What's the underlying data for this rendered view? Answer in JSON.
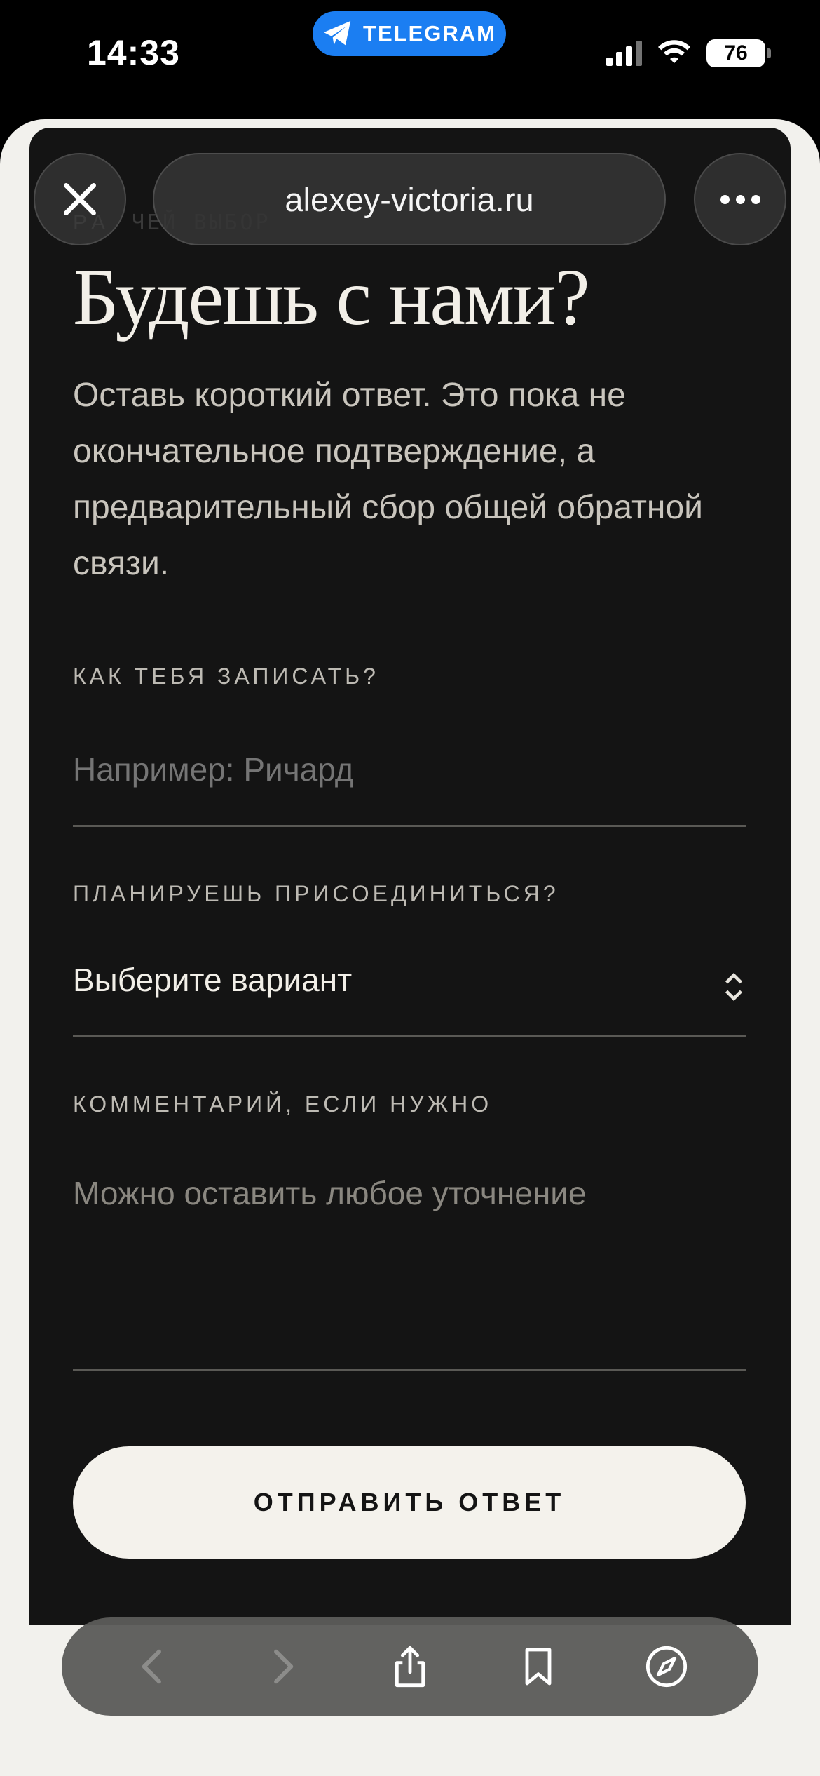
{
  "status_bar": {
    "time": "14:33",
    "app_pill": "TELEGRAM",
    "battery": "76"
  },
  "browser": {
    "url": "alexey-victoria.ru",
    "close_icon": "close-icon",
    "more_icon": "more-icon"
  },
  "page": {
    "eyebrow": "РА",
    "eyebrow_ghost": "ЧЕЙ ВЫБОР",
    "heading": "Будешь с нами?",
    "intro": "Оставь короткий ответ. Это пока не окончательное подтверждение, а предварительный сбор общей обратной связи.",
    "name_field": {
      "label": "КАК ТЕБЯ ЗАПИСАТЬ?",
      "placeholder": "Например: Ричард"
    },
    "join_field": {
      "label": "ПЛАНИРУЕШЬ ПРИСОЕДИНИТЬСЯ?",
      "selected": "Выберите вариант"
    },
    "comment_field": {
      "label": "КОММЕНТАРИЙ, ЕСЛИ НУЖНО",
      "placeholder": "Можно оставить любое уточнение"
    },
    "submit_label": "ОТПРАВИТЬ ОТВЕТ"
  },
  "toolbar": {
    "icons": [
      "back-icon",
      "forward-icon",
      "share-icon",
      "bookmark-icon",
      "compass-icon"
    ]
  },
  "colors": {
    "telegram": "#1b7ef2",
    "page_bg": "#141414",
    "text_light": "#f2efe8",
    "button_bg": "#f4f2ec"
  }
}
